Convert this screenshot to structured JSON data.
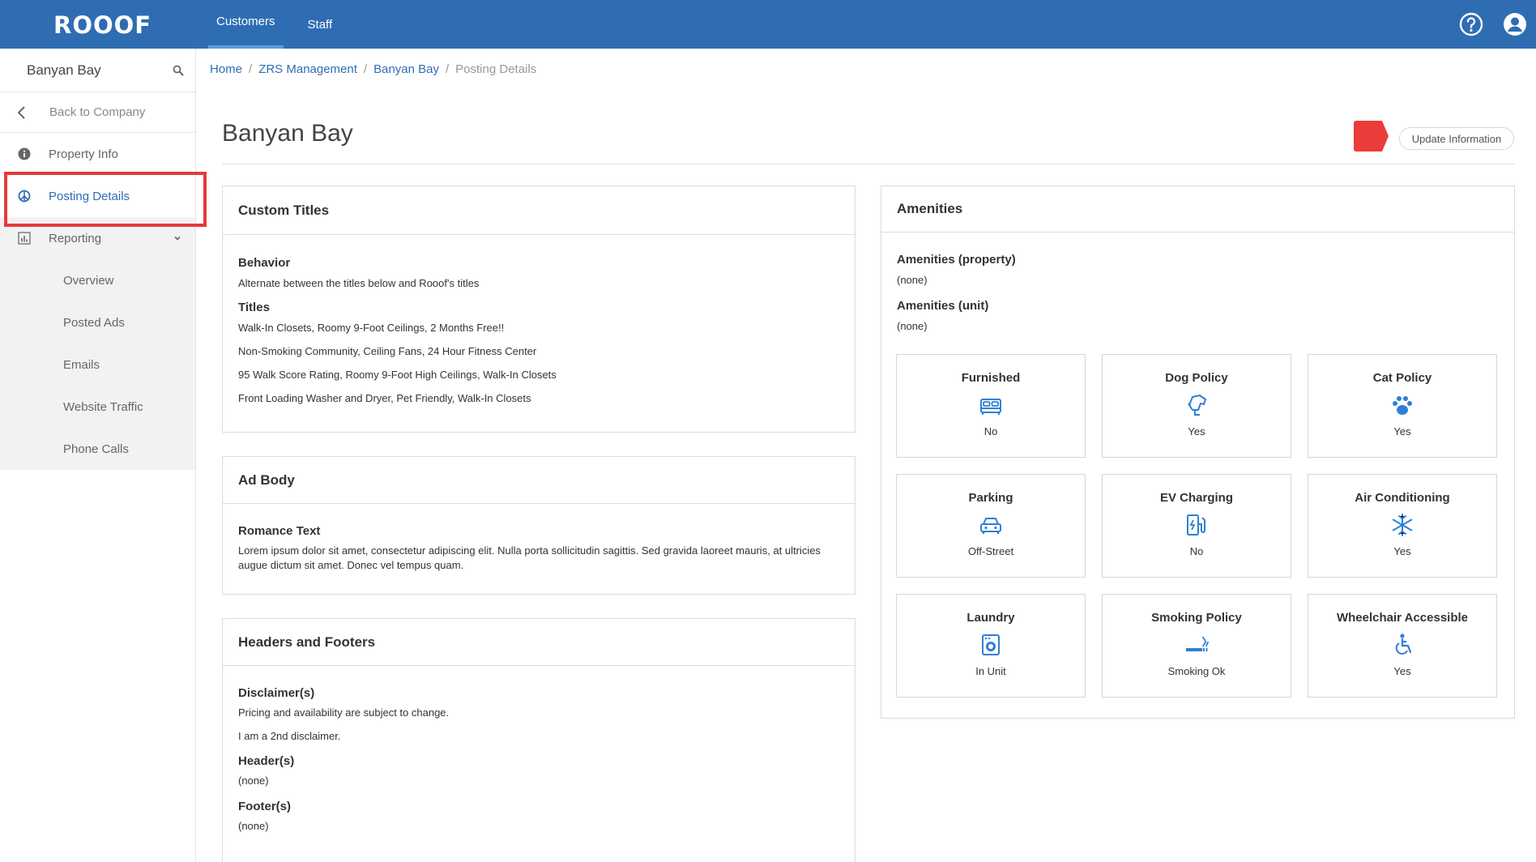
{
  "app": {
    "logo_text": "ROOOF",
    "nav_tabs": [
      {
        "label": "Customers",
        "active": true
      },
      {
        "label": "Staff",
        "active": false
      }
    ],
    "accent_color": "#2f6db3",
    "highlight_color": "#e53a3a"
  },
  "sidebar": {
    "title": "Banyan Bay",
    "back_label": "Back to Company",
    "items": [
      {
        "label": "Property Info",
        "icon": "info-icon"
      },
      {
        "label": "Posting Details",
        "icon": "peace-icon",
        "active": true
      },
      {
        "label": "Reporting",
        "icon": "chart-icon"
      }
    ],
    "reporting_items": [
      "Overview",
      "Posted Ads",
      "Emails",
      "Website Traffic",
      "Phone Calls"
    ]
  },
  "breadcrumb": [
    "Home",
    "ZRS Management",
    "Banyan Bay",
    "Posting Details"
  ],
  "page": {
    "title": "Banyan Bay",
    "update_button": "Update Information"
  },
  "custom_titles": {
    "heading": "Custom Titles",
    "behavior_label": "Behavior",
    "behavior_text": "Alternate between the titles below and Rooof's titles",
    "titles_label": "Titles",
    "titles": [
      "Walk-In Closets, Roomy 9-Foot Ceilings, 2 Months Free!!",
      "Non-Smoking Community, Ceiling Fans, 24 Hour Fitness Center",
      "95 Walk Score Rating, Roomy 9-Foot High Ceilings, Walk-In Closets",
      "Front Loading Washer and Dryer, Pet Friendly, Walk-In Closets"
    ]
  },
  "ad_body": {
    "heading": "Ad Body",
    "romance_label": "Romance Text",
    "romance_text": "Lorem ipsum dolor sit amet, consectetur adipiscing elit. Nulla porta sollicitudin sagittis. Sed gravida laoreet mauris, at ultricies augue dictum sit amet. Donec vel tempus quam."
  },
  "headers_footers": {
    "heading": "Headers and Footers",
    "disclaimers_label": "Disclaimer(s)",
    "disclaimers": [
      "Pricing and availability are subject to change.",
      "I am a 2nd disclaimer."
    ],
    "headers_label": "Header(s)",
    "headers_value": "(none)",
    "footers_label": "Footer(s)",
    "footers_value": "(none)"
  },
  "amenities": {
    "heading": "Amenities",
    "property_label": "Amenities (property)",
    "property_value": "(none)",
    "unit_label": "Amenities (unit)",
    "unit_value": "(none)",
    "tiles": [
      {
        "name": "Furnished",
        "value": "No",
        "icon": "bed-icon"
      },
      {
        "name": "Dog Policy",
        "value": "Yes",
        "icon": "dog-icon"
      },
      {
        "name": "Cat Policy",
        "value": "Yes",
        "icon": "paw-icon"
      },
      {
        "name": "Parking",
        "value": "Off-Street",
        "icon": "car-icon"
      },
      {
        "name": "EV Charging",
        "value": "No",
        "icon": "ev-charger-icon"
      },
      {
        "name": "Air Conditioning",
        "value": "Yes",
        "icon": "snowflake-icon"
      },
      {
        "name": "Laundry",
        "value": "In Unit",
        "icon": "washer-icon"
      },
      {
        "name": "Smoking Policy",
        "value": "Smoking Ok",
        "icon": "smoking-icon"
      },
      {
        "name": "Wheelchair Accessible",
        "value": "Yes",
        "icon": "wheelchair-icon"
      }
    ]
  }
}
